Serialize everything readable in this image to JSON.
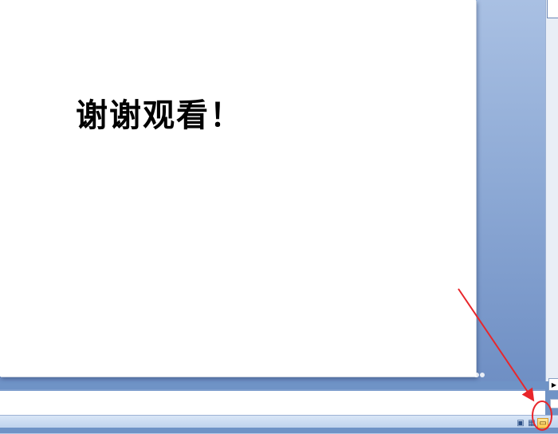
{
  "slide": {
    "text": "谢谢观看！"
  },
  "right_pane": {
    "button_glyph": "▶"
  },
  "status_bar": {
    "view_buttons": [
      {
        "name": "normal-view-icon",
        "glyph": "▣"
      },
      {
        "name": "slide-sorter-view-icon",
        "glyph": "▦"
      },
      {
        "name": "slide-show-view-icon",
        "glyph": "▭"
      }
    ]
  },
  "annotation": {
    "color": "#e8262b",
    "shape": "arrow pointing to circled slide-show view button"
  }
}
